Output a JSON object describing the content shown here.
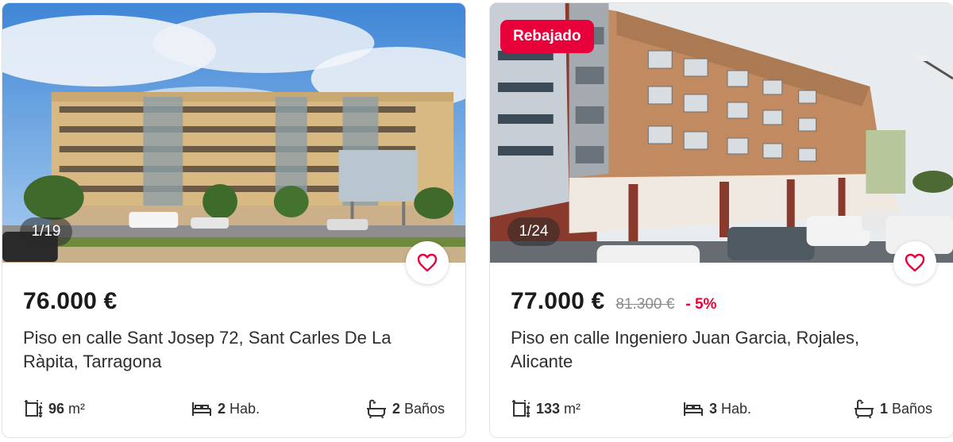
{
  "colors": {
    "accent": "#e8003a",
    "text": "#1b1b1b",
    "muted": "#8a8a8a"
  },
  "listings": [
    {
      "photo_counter": "1/19",
      "price": "76.000 €",
      "title": "Piso en calle Sant Josep 72, Sant Carles De La Ràpita, Tarragona",
      "features": {
        "area": "96",
        "area_unit": "m²",
        "rooms": "2",
        "rooms_label": "Hab.",
        "baths": "2",
        "baths_label": "Baños"
      },
      "favorite_icon": "heart-icon"
    },
    {
      "badge": "Rebajado",
      "photo_counter": "1/24",
      "price": "77.000 €",
      "old_price": "81.300 €",
      "discount": "- 5%",
      "title": "Piso en calle Ingeniero Juan Garcia, Rojales, Alicante",
      "features": {
        "area": "133",
        "area_unit": "m²",
        "rooms": "3",
        "rooms_label": "Hab.",
        "baths": "1",
        "baths_label": "Baños"
      },
      "favorite_icon": "heart-icon"
    }
  ]
}
